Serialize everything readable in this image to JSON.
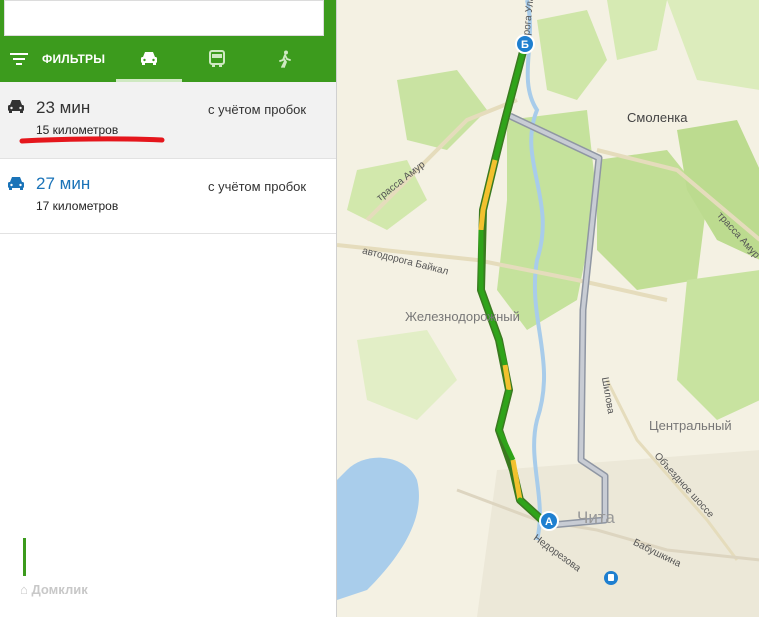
{
  "toolbar": {
    "filters_label": "ФИЛЬТРЫ"
  },
  "routes": [
    {
      "time": "23 мин",
      "distance": "15 километров",
      "traffic": "с учётом пробок"
    },
    {
      "time": "27 мин",
      "distance": "17 километров",
      "traffic": "с учётом пробок"
    }
  ],
  "map": {
    "places": {
      "smolenka": "Смоленка",
      "zheleznodorozhny": "Железнодорожный",
      "centralny": "Центральный",
      "chita": "Чита"
    },
    "roads": {
      "trassa_amur_left": "трасса Амур",
      "trassa_amur_right": "трасса Амур",
      "baikal": "автодорога Байкал",
      "ulan": "рога Ула",
      "shilova": "Шилова",
      "obezdnoe": "Объездное шоссе",
      "nedorezova": "Недорезова",
      "babushkina": "Бабушкина"
    },
    "markers": {
      "start": "А",
      "end": "Б"
    }
  },
  "watermark": "Домклик",
  "colors": {
    "header_green": "#3c9b1d",
    "active_time_blue": "#1a73b8",
    "route_green": "#2fa31a",
    "route_yellow": "#f2c12e",
    "alt_route_gray": "#9aa0aa",
    "marker_blue": "#1e7fd0",
    "annotation_red": "#e5161c"
  }
}
